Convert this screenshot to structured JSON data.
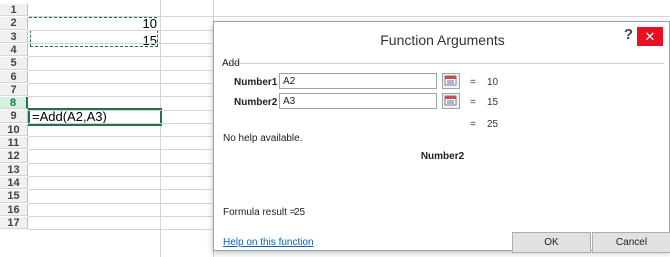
{
  "sheet": {
    "rows": [
      "1",
      "2",
      "3",
      "4",
      "5",
      "6",
      "7",
      "8",
      "9",
      "10",
      "11",
      "12",
      "13",
      "14",
      "15",
      "16",
      "17"
    ],
    "cells": {
      "a2": "10",
      "a3": "15",
      "a8": "=Add(A2,A3)"
    }
  },
  "dialog": {
    "title": "Function Arguments",
    "help_glyph": "?",
    "close_glyph": "✕",
    "function_name": "Add",
    "args": [
      {
        "label": "Number1",
        "value": "A2",
        "equals": "=",
        "result": "10"
      },
      {
        "label": "Number2",
        "value": "A3",
        "equals": "=",
        "result": "15"
      }
    ],
    "total_equals": "=",
    "total": "25",
    "no_help": "No help available.",
    "focus_arg": "Number2",
    "formula_result_label": "Formula result =",
    "formula_result_value": "25",
    "help_link": "Help on this function",
    "ok": "OK",
    "cancel": "Cancel"
  },
  "colors": {
    "excel_green": "#217346",
    "close_red": "#e81123",
    "link_blue": "#0563c1"
  },
  "icons": {
    "ref_button": "collapse-dialog-icon"
  }
}
